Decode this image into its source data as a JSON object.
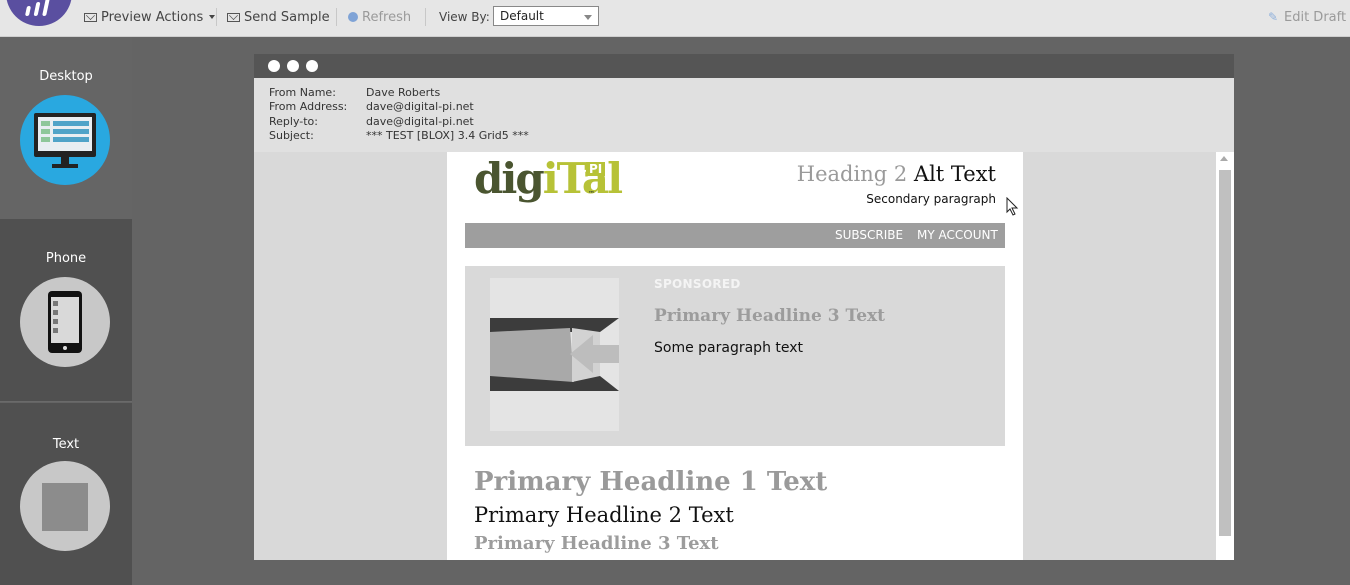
{
  "toolbar": {
    "preview_actions": "Preview Actions",
    "send_sample": "Send Sample",
    "refresh": "Refresh",
    "view_by_label": "View By:",
    "view_by_value": "Default",
    "edit_draft": "Edit Draft"
  },
  "devices": [
    {
      "label": "Desktop",
      "selected": true,
      "icon": "desktop-monitor-icon",
      "color": "#29a8e0"
    },
    {
      "label": "Phone",
      "selected": false,
      "icon": "phone-icon",
      "color": "#c8c8c8"
    },
    {
      "label": "Text",
      "selected": false,
      "icon": "text-page-icon",
      "color": "#c8c8c8"
    }
  ],
  "email_meta": {
    "from_name_label": "From Name:",
    "from_name": "Dave Roberts",
    "from_address_label": "From Address:",
    "from_address": "dave@digital-pi.net",
    "reply_to_label": "Reply-to:",
    "reply_to": "dave@digital-pi.net",
    "subject_label": "Subject:",
    "subject": "*** TEST [BLOX] 3.4 Grid5 ***"
  },
  "email": {
    "brand_left": "dig",
    "brand_mid": "iTal",
    "brand_badge": "PI",
    "brand_tm": "™",
    "heading2_grey": "Heading 2",
    "heading2_dark": "Alt Text",
    "secondary_paragraph": "Secondary paragraph",
    "nav_subscribe": "SUBSCRIBE",
    "nav_account": "MY ACCOUNT",
    "sponsored_label": "SPONSORED",
    "sponsored_headline": "Primary Headline 3 Text",
    "sponsored_paragraph": "Some paragraph text",
    "headline1": "Primary Headline 1 Text",
    "headline2": "Primary Headline 2 Text",
    "headline3": "Primary Headline 3 Text"
  },
  "colors": {
    "accent_brand": "#b7c237",
    "brand_dark": "#4a5530",
    "desktop_circle": "#29a8e0",
    "app_logo": "#5a4fa0"
  }
}
